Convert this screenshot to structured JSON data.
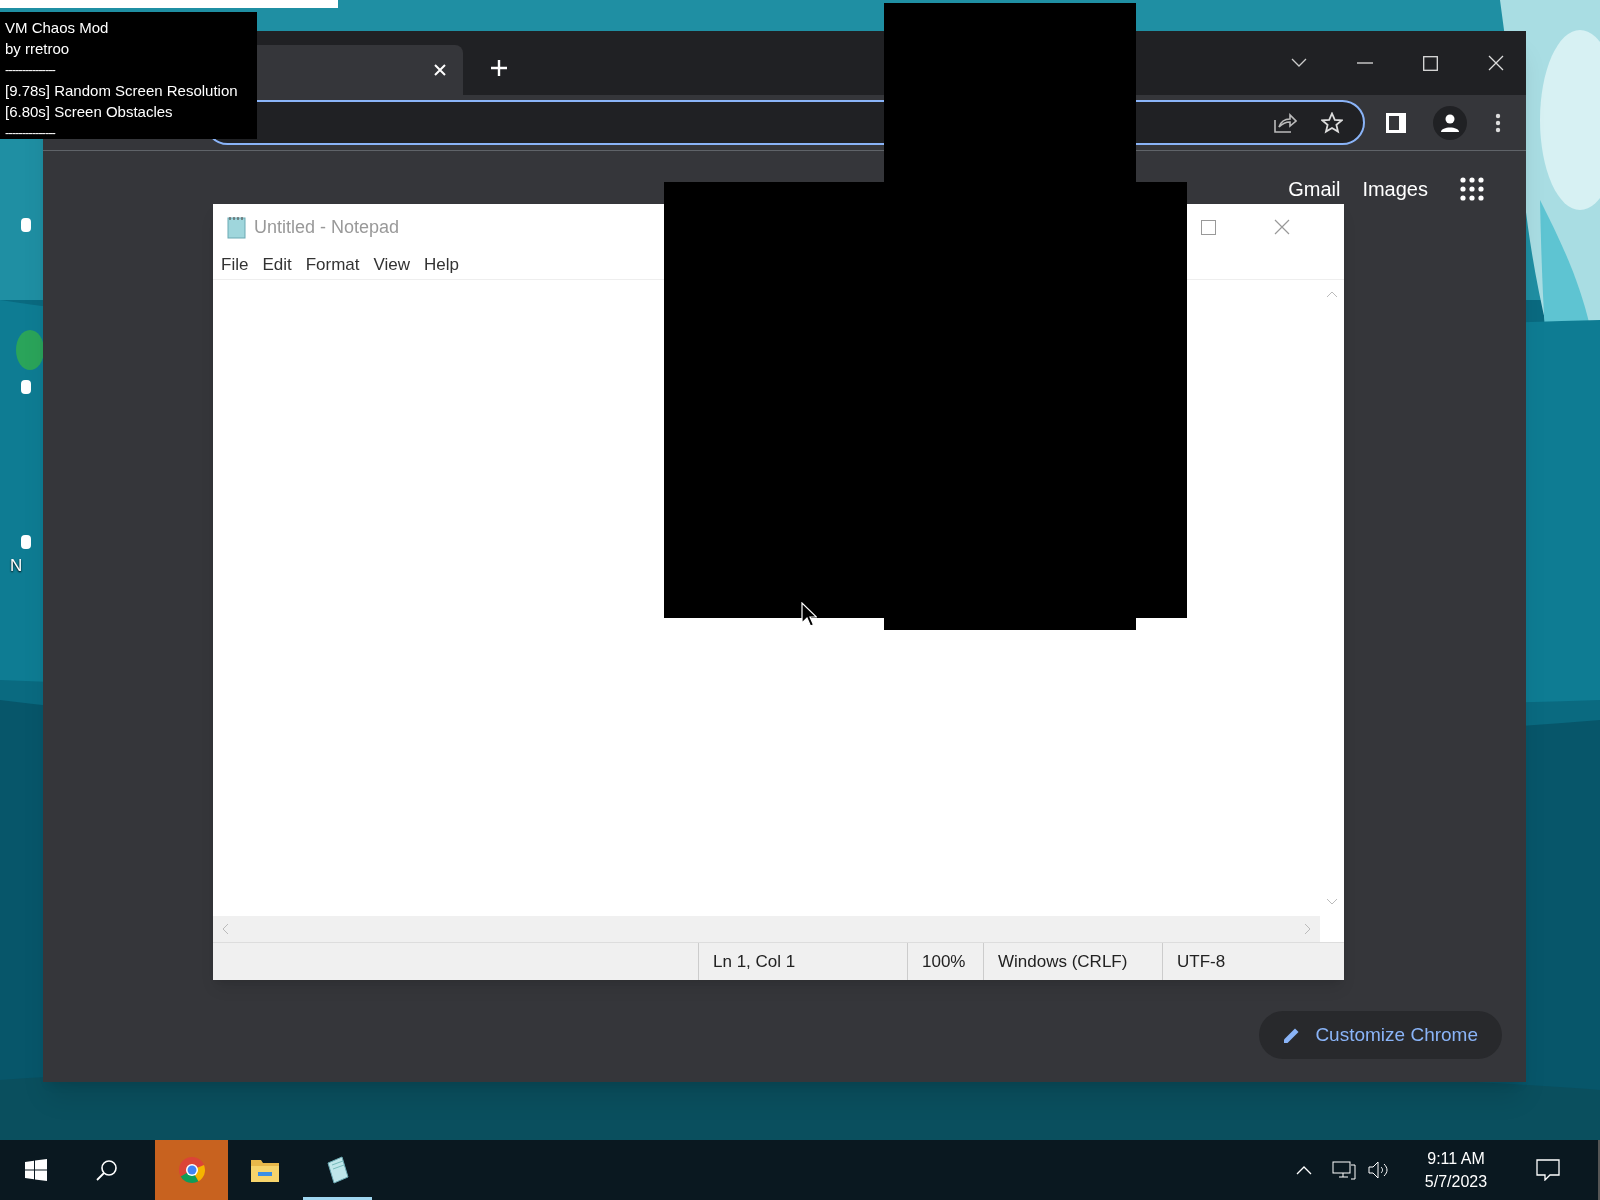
{
  "desktop": {
    "icon_label": "N"
  },
  "overlay": {
    "lines": [
      {
        "kind": "text",
        "text": "VM Chaos Mod"
      },
      {
        "kind": "text",
        "text": "by rretroo"
      },
      {
        "kind": "rule",
        "text": "---------------"
      },
      {
        "kind": "text",
        "text": "[9.78s] Random Screen Resolution"
      },
      {
        "kind": "text",
        "text": "[6.80s] Screen Obstacles"
      },
      {
        "kind": "rule",
        "text": "---------------"
      }
    ]
  },
  "browser": {
    "links": [
      "Gmail",
      "Images"
    ],
    "customize_button": "Customize Chrome"
  },
  "notepad": {
    "title": "Untitled - Notepad",
    "menu": [
      "File",
      "Edit",
      "Format",
      "View",
      "Help"
    ],
    "status_bar": [
      "Ln 1, Col 1",
      "100%",
      "Windows (CRLF)",
      "UTF-8"
    ]
  },
  "taskbar": {
    "apps": [
      {
        "kind": "chrome",
        "selected": true,
        "open": false
      },
      {
        "kind": "explorer",
        "selected": false,
        "open": false
      },
      {
        "kind": "notepad",
        "selected": false,
        "open": true
      }
    ],
    "time": "9:11 AM",
    "date": "5/7/2023"
  }
}
